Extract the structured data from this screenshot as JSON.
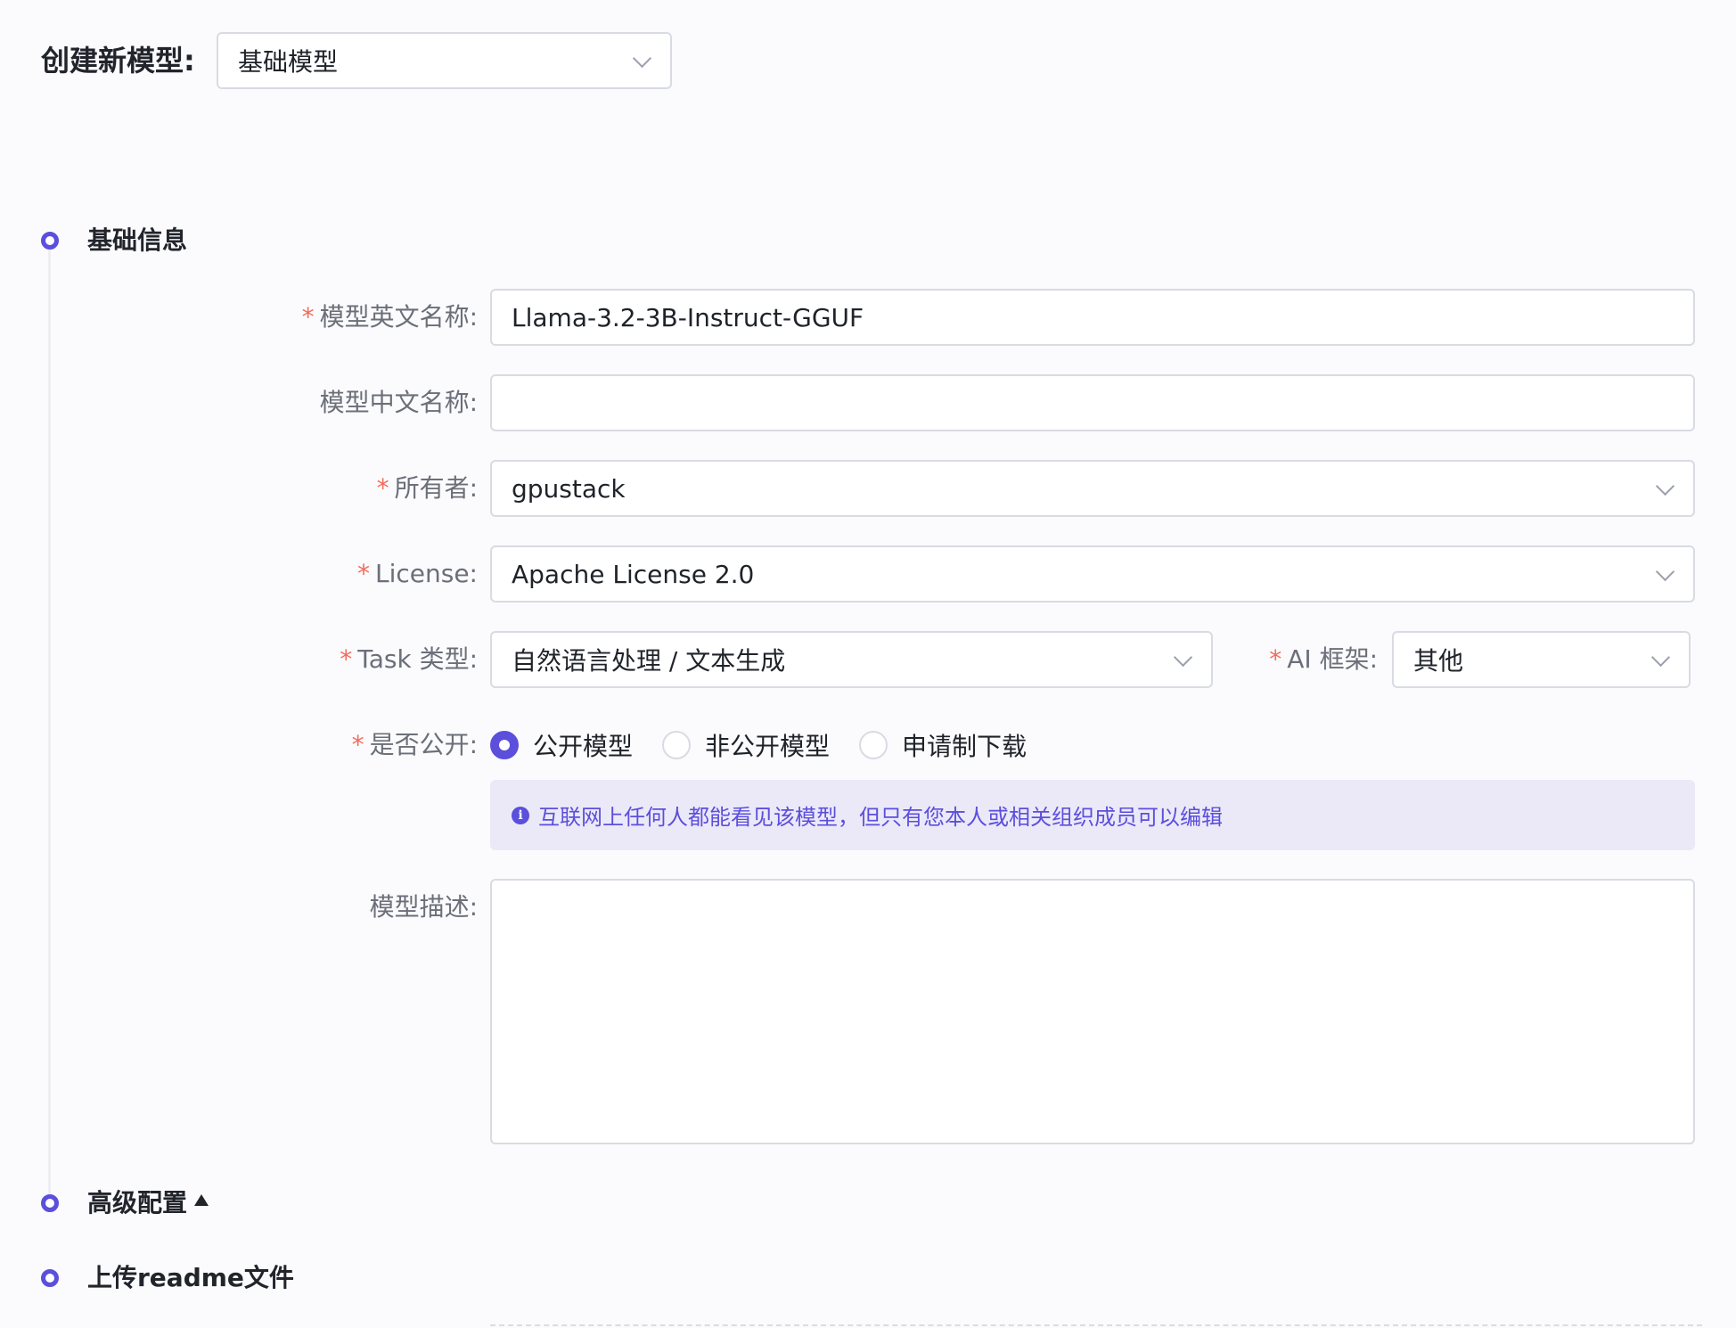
{
  "header": {
    "create_label": "创建新模型:",
    "model_type_value": "基础模型"
  },
  "sections": {
    "basic_info": "基础信息",
    "advanced_config": "高级配置",
    "upload_readme": "上传readme文件"
  },
  "form": {
    "required_mark": "*",
    "en_name_label": "模型英文名称:",
    "en_name_value": "Llama-3.2-3B-Instruct-GGUF",
    "cn_name_label": "模型中文名称:",
    "cn_name_value": "",
    "owner_label": "所有者:",
    "owner_value": "gpustack",
    "license_label": "License:",
    "license_value": "Apache License 2.0",
    "task_label": "Task 类型:",
    "task_value": "自然语言处理 / 文本生成",
    "framework_label": "AI 框架:",
    "framework_value": "其他",
    "public_label": "是否公开:",
    "public_options": [
      "公开模型",
      "非公开模型",
      "申请制下载"
    ],
    "public_selected": "公开模型",
    "info_icon": "i",
    "info_text": "互联网上任何人都能看见该模型，但只有您本人或相关组织成员可以编辑",
    "desc_label": "模型描述:",
    "desc_value": ""
  },
  "colors": {
    "accent": "#5b4fdc",
    "required": "#f26b5b",
    "info_bg": "#ebe9f8"
  }
}
